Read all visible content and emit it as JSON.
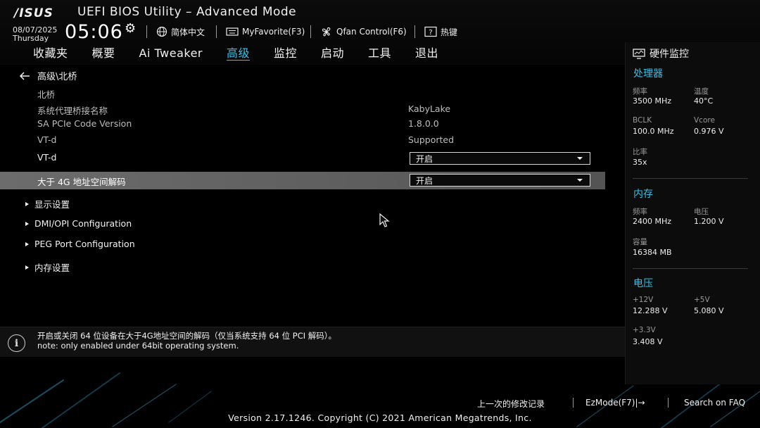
{
  "header": {
    "logo": "/ISUS",
    "title": "UEFI BIOS Utility – Advanced Mode",
    "date": "08/07/2025",
    "weekday": "Thursday",
    "time": "05:06",
    "language": "简体中文",
    "myfavorite": "MyFavorite(F3)",
    "qfan": "Qfan Control(F6)",
    "hotkeys": "热键"
  },
  "tabs": [
    {
      "label": "收藏夹"
    },
    {
      "label": "概要"
    },
    {
      "label": "Ai Tweaker"
    },
    {
      "label": "高级",
      "active": true
    },
    {
      "label": "监控"
    },
    {
      "label": "启动"
    },
    {
      "label": "工具"
    },
    {
      "label": "退出"
    }
  ],
  "main": {
    "breadcrumb": "高级\\北桥",
    "section": "北桥",
    "rows": [
      {
        "label": "系统代理桥接名称",
        "value": "KabyLake"
      },
      {
        "label": "SA PCIe Code Version",
        "value": "1.8.0.0"
      },
      {
        "label": "VT-d",
        "value": "Supported"
      }
    ],
    "vtd": {
      "label": "VT-d",
      "value": "开启"
    },
    "above4g": {
      "label": "大于 4G 地址空间解码",
      "value": "开启"
    },
    "submenus": [
      "显示设置",
      "DMI/OPI Configuration",
      "PEG Port Configuration",
      "内存设置"
    ]
  },
  "info": {
    "line1": "开启或关闭 64 位设备在大于4G地址空间的解码（仅当系统支持 64 位 PCI 解码）。",
    "line2": "note: only enabled under 64bit operating system."
  },
  "hw": {
    "title": "硬件监控",
    "cpu": {
      "title": "处理器",
      "freq_label": "频率",
      "freq": "3500 MHz",
      "temp_label": "温度",
      "temp": "40°C",
      "bclk_label": "BCLK",
      "bclk": "100.0 MHz",
      "vcore_label": "Vcore",
      "vcore": "0.976 V",
      "ratio_label": "比率",
      "ratio": "35x"
    },
    "mem": {
      "title": "内存",
      "freq_label": "频率",
      "freq": "2400 MHz",
      "volt_label": "电压",
      "volt": "1.200 V",
      "cap_label": "容量",
      "cap": "16384 MB"
    },
    "volt": {
      "title": "电压",
      "v12_label": "+12V",
      "v12": "12.288 V",
      "v5_label": "+5V",
      "v5": "5.080 V",
      "v33_label": "+3.3V",
      "v33": "3.408 V"
    }
  },
  "footer": {
    "last_changes": "上一次的修改记录",
    "ezmode": "EzMode(F7)|→",
    "search": "Search on FAQ",
    "version": "Version 2.17.1246. Copyright (C) 2021 American Megatrends, Inc."
  },
  "colors": {
    "accent": "#35c0e8",
    "selected_row": "#636363",
    "background": "#000000"
  }
}
